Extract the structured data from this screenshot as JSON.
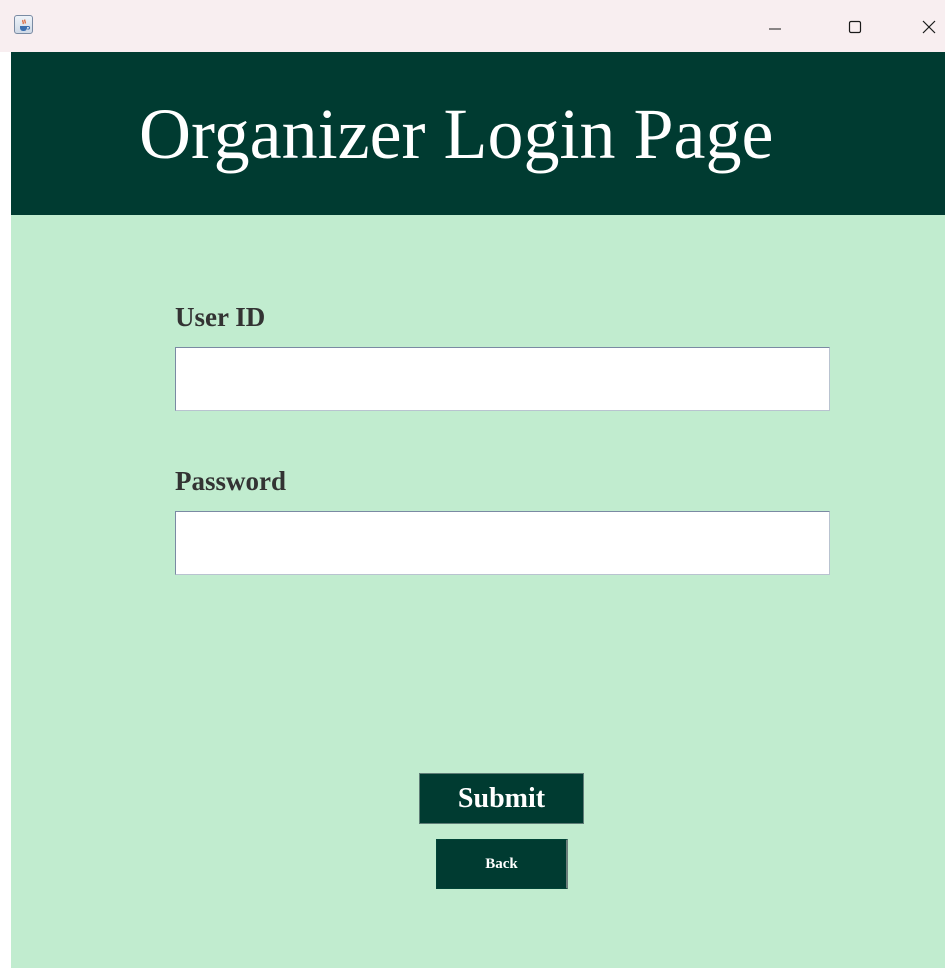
{
  "window": {
    "icon": "java-cup-icon",
    "controls": {
      "minimize_icon": "minimize-icon",
      "maximize_icon": "maximize-icon",
      "close_icon": "close-icon"
    }
  },
  "header": {
    "title": "Organizer Login Page",
    "background": "#003b31",
    "text_color": "#ffffff"
  },
  "form": {
    "background": "#c1eccf",
    "user_id": {
      "label": "User ID",
      "value": "",
      "placeholder": ""
    },
    "password": {
      "label": "Password",
      "value": "",
      "placeholder": ""
    }
  },
  "buttons": {
    "submit_label": "Submit",
    "back_label": "Back",
    "color": "#003b31"
  }
}
